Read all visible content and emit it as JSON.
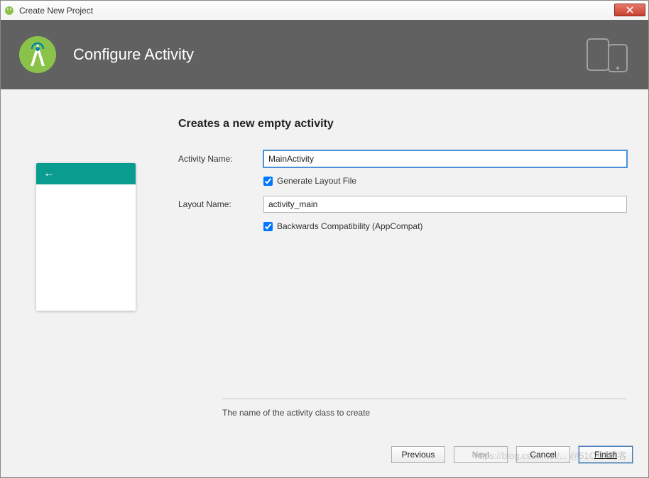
{
  "window": {
    "title": "Create New Project"
  },
  "header": {
    "title": "Configure Activity"
  },
  "form": {
    "heading": "Creates a new empty activity",
    "activity_name_label": "Activity Name:",
    "activity_name_value": "MainActivity",
    "generate_layout_label": "Generate Layout File",
    "generate_layout_checked": true,
    "layout_name_label": "Layout Name:",
    "layout_name_value": "activity_main",
    "backwards_compat_label": "Backwards Compatibility (AppCompat)",
    "backwards_compat_checked": true
  },
  "help_text": "The name of the activity class to create",
  "buttons": {
    "previous": "Previous",
    "next": "Next",
    "cancel": "Cancel",
    "finish": "Finish"
  },
  "watermark": "https://blog.csdn.net/... @51CTO博客"
}
